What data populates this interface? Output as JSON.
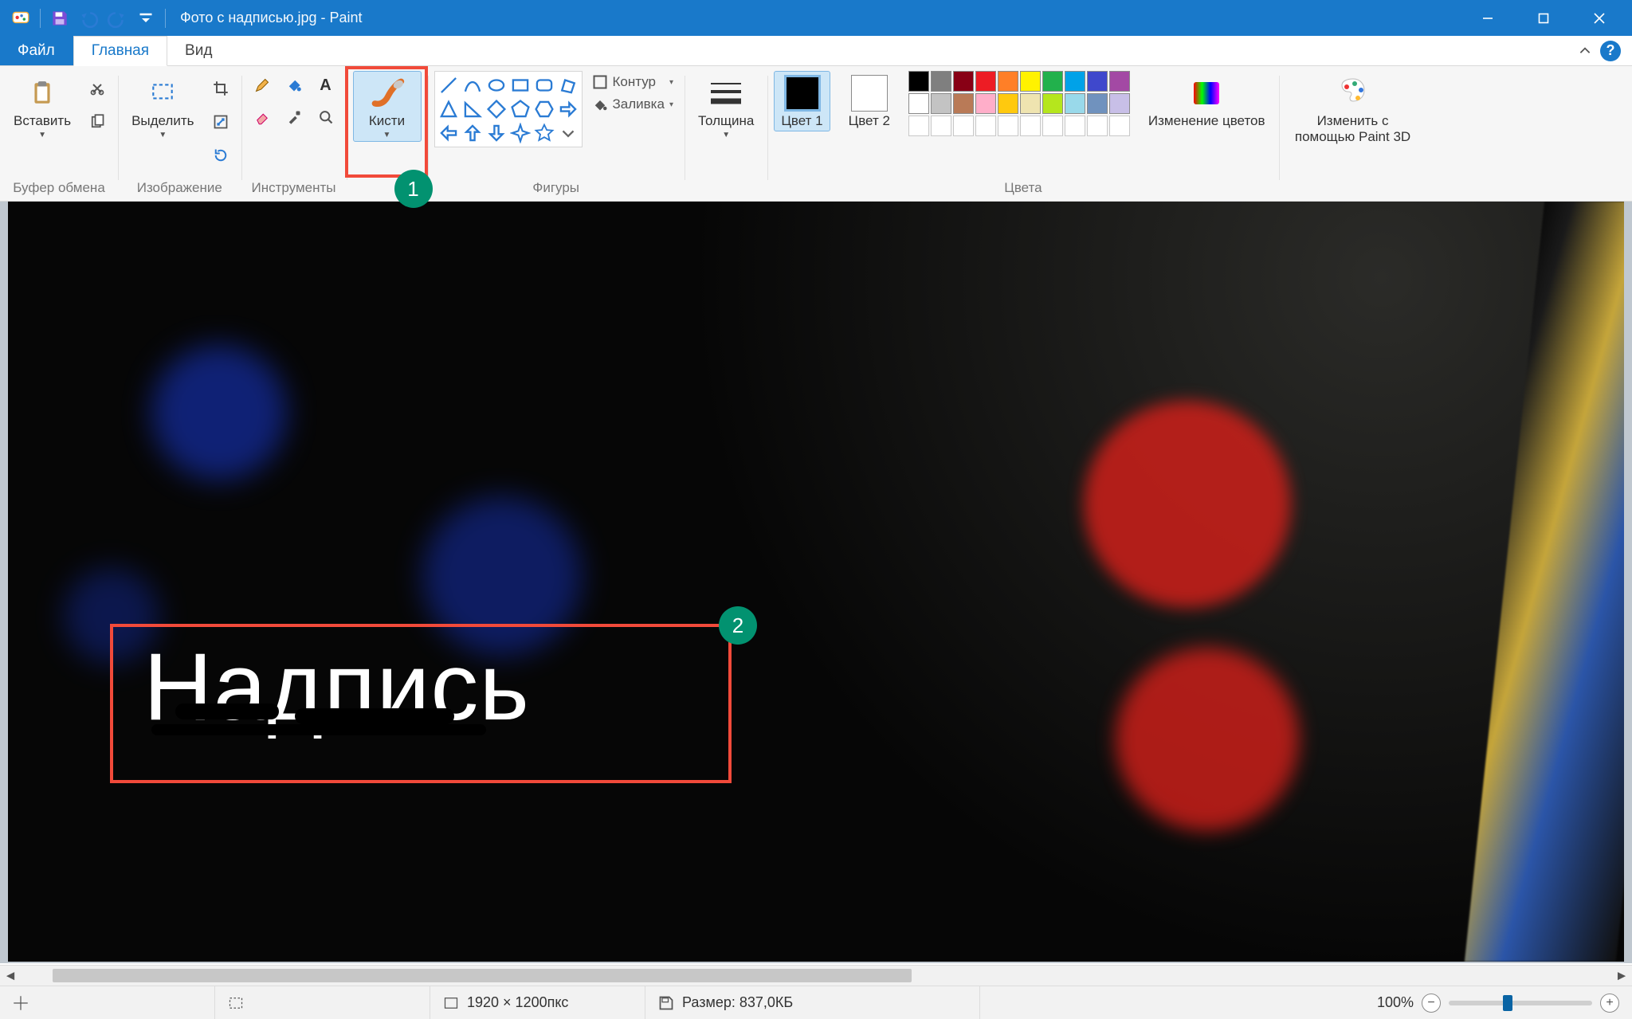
{
  "window": {
    "title": "Фото с надписью.jpg - Paint"
  },
  "tabs": {
    "file": "Файл",
    "home": "Главная",
    "view": "Вид"
  },
  "ribbon": {
    "clipboard": {
      "paste": "Вставить",
      "group_label": "Буфер обмена"
    },
    "image": {
      "select": "Выделить",
      "group_label": "Изображение"
    },
    "tools": {
      "group_label": "Инструменты"
    },
    "brushes": {
      "label": "Кисти"
    },
    "shapes": {
      "outline": "Контур",
      "fill": "Заливка",
      "group_label": "Фигуры"
    },
    "thickness": {
      "label": "Толщина"
    },
    "colors": {
      "color1": "Цвет 1",
      "color2": "Цвет 2",
      "edit_colors": "Изменение цветов",
      "group_label": "Цвета",
      "palette_row1": [
        "#000000",
        "#7f7f7f",
        "#880015",
        "#ed1c24",
        "#ff7f27",
        "#fff200",
        "#22b14c",
        "#00a2e8",
        "#3f48cc",
        "#a349a4"
      ],
      "palette_row2": [
        "#ffffff",
        "#c3c3c3",
        "#b97a57",
        "#ffaec9",
        "#ffc90e",
        "#efe4b0",
        "#b5e61d",
        "#99d9ea",
        "#7092be",
        "#c8bfe7"
      ],
      "palette_row3_empty": 10
    },
    "paint3d": {
      "label_line1": "Изменить с",
      "label_line2": "помощью Paint 3D"
    }
  },
  "annotations": {
    "badge1": "1",
    "badge2": "2",
    "overlay_text": "Надпись"
  },
  "statusbar": {
    "dimensions": "1920 × 1200пкс",
    "size_label": "Размер: 837,0КБ",
    "zoom": "100%",
    "zoom_fraction": 0.38
  }
}
